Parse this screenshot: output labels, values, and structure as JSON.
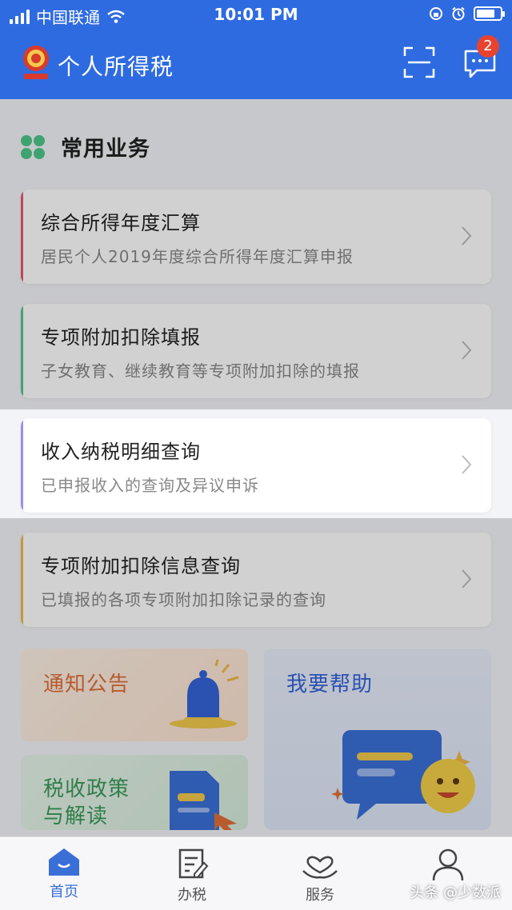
{
  "status_bar": {
    "carrier": "中国联通",
    "time": "10:01 PM"
  },
  "header": {
    "title": "个人所得税",
    "message_badge": "2"
  },
  "section": {
    "title": "常用业务"
  },
  "cards": [
    {
      "title": "综合所得年度汇算",
      "subtitle": "居民个人2019年度综合所得年度汇算申报",
      "accent": "#e8566a"
    },
    {
      "title": "专项附加扣除填报",
      "subtitle": "子女教育、继续教育等专项附加扣除的填报",
      "accent": "#4ec78a"
    },
    {
      "title": "收入纳税明细查询",
      "subtitle": "已申报收入的查询及异议申诉",
      "accent": "#9a8cf0"
    },
    {
      "title": "专项附加扣除信息查询",
      "subtitle": "已填报的各项专项附加扣除记录的查询",
      "accent": "#f0b94a"
    }
  ],
  "tiles": {
    "notice": "通知公告",
    "help": "我要帮助",
    "policy_line1": "税收政策",
    "policy_line2": "与解读"
  },
  "nav": [
    {
      "label": "首页",
      "icon": "home-icon"
    },
    {
      "label": "办税",
      "icon": "edit-document-icon"
    },
    {
      "label": "服务",
      "icon": "heart-hand-icon"
    },
    {
      "label": "",
      "icon": "person-icon"
    }
  ],
  "watermark": "头条 @少数派",
  "colors": {
    "brand": "#2f6be0",
    "nav_active": "#3a6fd8",
    "nav_inactive": "#555555"
  }
}
